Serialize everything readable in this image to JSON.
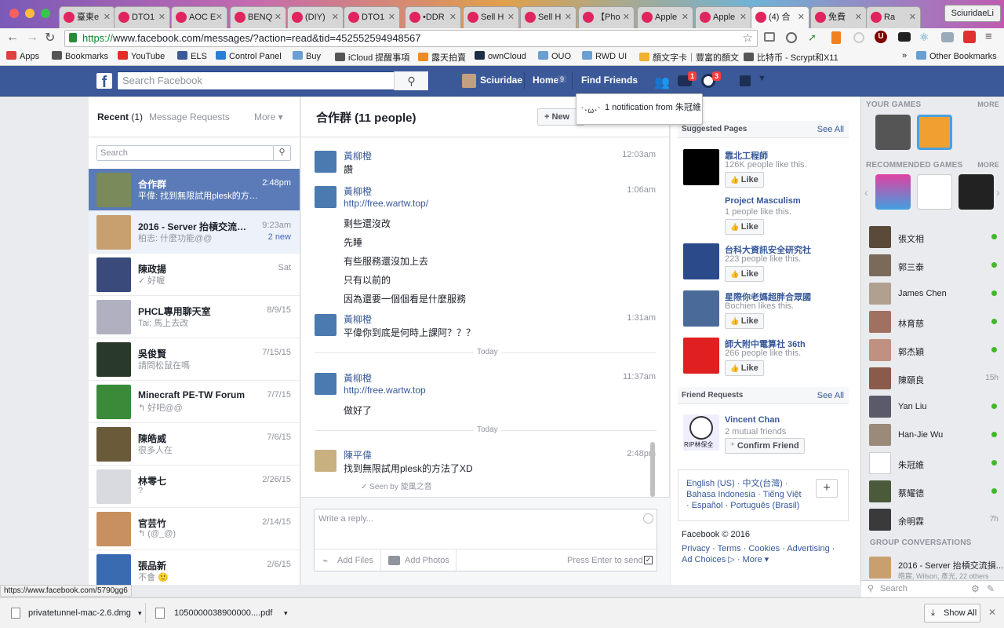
{
  "browser": {
    "tabs": [
      {
        "label": "臺東e",
        "active": false
      },
      {
        "label": "DTO1",
        "active": false
      },
      {
        "label": "AOC E",
        "active": false
      },
      {
        "label": "BENQ",
        "active": false
      },
      {
        "label": "(DIY)",
        "active": false
      },
      {
        "label": "DTO1",
        "active": false
      },
      {
        "label": "•DDR",
        "active": false
      },
      {
        "label": "Sell H",
        "active": false
      },
      {
        "label": "Sell H",
        "active": false
      },
      {
        "label": "【Pho",
        "active": false
      },
      {
        "label": "Apple",
        "active": false
      },
      {
        "label": "Apple",
        "active": false
      },
      {
        "label": "(4) 合",
        "active": true
      },
      {
        "label": "免費",
        "active": false
      },
      {
        "label": "Ra",
        "active": false
      }
    ],
    "profile_name": "SciuridaeLi",
    "url_scheme": "https://",
    "url_rest": "www.facebook.com/messages/?action=read&tid=452552594948567",
    "bookmarks": [
      {
        "label": "Apps",
        "color": "#e04040"
      },
      {
        "label": "Bookmarks",
        "color": "#555555"
      },
      {
        "label": "YouTube",
        "color": "#e52d27"
      },
      {
        "label": "ELS",
        "color": "#3b5998"
      },
      {
        "label": "Control Panel",
        "color": "#2a7fd4"
      },
      {
        "label": "Buy",
        "color": "#6a9fd4"
      },
      {
        "label": "iCloud 提醒事項",
        "color": "#555555"
      },
      {
        "label": "露天拍賣",
        "color": "#f08a24"
      },
      {
        "label": "ownCloud",
        "color": "#1d2d44"
      },
      {
        "label": "OUO",
        "color": "#6a9fd4"
      },
      {
        "label": "RWD UI",
        "color": "#6a9fd4"
      },
      {
        "label": "顏文字卡｜豐富的顏文",
        "color": "#f0b030"
      },
      {
        "label": "比特币 - Scrypt和X11",
        "color": "#555555"
      }
    ],
    "bookmarks_more": "»",
    "other_bookmarks": "Other Bookmarks",
    "status_url": "https://www.facebook.com/5790gg6"
  },
  "fb": {
    "search_placeholder": "Search Facebook",
    "user_name": "Sciuridae",
    "home_label": "Home",
    "home_count": "9",
    "find_friends": "Find Friends",
    "messages_badge": "1",
    "notif_badge": "3",
    "notif_popup": "1 notification from 朱冠維",
    "notif_face": "´･ω･`"
  },
  "inbox": {
    "tab_recent": "Recent",
    "tab_recent_count": "(1)",
    "tab_requests": "Message Requests",
    "tab_more": "More ▾",
    "search_placeholder": "Search",
    "conversations": [
      {
        "name": "合作群",
        "snippet": "平偉: 找到無限試用plesk的方法了..",
        "time": "2:48pm",
        "new": "",
        "state": "selected",
        "color": "#7a8a5a"
      },
      {
        "name": "2016 - Server 抬槓交流損友...",
        "snippet": "柏志: 什麼功能@@",
        "time": "9:23am",
        "new": "2 new",
        "state": "unread",
        "color": "#c8a070"
      },
      {
        "name": "陳政揚",
        "snippet": "✓ 好喔",
        "time": "Sat",
        "new": "",
        "state": "",
        "color": "#3a4a7a"
      },
      {
        "name": "PHCL專用聊天室",
        "snippet": "Tai: 馬上去改",
        "time": "8/9/15",
        "new": "",
        "state": "",
        "color": "#b0b0c0"
      },
      {
        "name": "吳俊賢",
        "snippet": "請問松鼠在嗎",
        "time": "7/15/15",
        "new": "",
        "state": "",
        "color": "#2a3a2a"
      },
      {
        "name": "Minecraft PE-TW Forum",
        "snippet": "↰ 好吧@@",
        "time": "7/7/15",
        "new": "",
        "state": "",
        "color": "#3a8a3a"
      },
      {
        "name": "陳皓威",
        "snippet": "很多人在",
        "time": "7/6/15",
        "new": "",
        "state": "",
        "color": "#6a5a3a"
      },
      {
        "name": "林零七",
        "snippet": "?",
        "time": "2/26/15",
        "new": "",
        "state": "",
        "color": "#d8dadf"
      },
      {
        "name": "官芸竹",
        "snippet": "↰ (@_@)",
        "time": "2/14/15",
        "new": "",
        "state": "",
        "color": "#c89060"
      },
      {
        "name": "張品新",
        "snippet": "不會 🙂",
        "time": "2/6/15",
        "new": "",
        "state": "",
        "color": "#3a6ab0"
      }
    ]
  },
  "thread": {
    "title": "合作群 (11 people)",
    "new_button": "+ New",
    "today_label": "Today",
    "seen_text": "✓ Seen by 旋風之音",
    "reply_placeholder": "Write a reply...",
    "add_files": "Add Files",
    "add_photos": "Add Photos",
    "press_enter": "Press Enter to send",
    "messages": [
      {
        "sender": "黃柳橙",
        "time": "12:03am",
        "lines": [
          "讚"
        ]
      },
      {
        "sender": "黃柳橙",
        "time": "1:06am",
        "lines": [
          "http://free.wartw.top/",
          "剩些還沒改",
          "先睡",
          "有些服務還沒加上去",
          "只有以前的",
          "因為還要一個個看是什麼服務"
        ]
      },
      {
        "sender": "黃柳橙",
        "time": "1:31am",
        "lines": [
          "平偉你到底是何時上課阿？？？"
        ]
      },
      {
        "sender": "黃柳橙",
        "time": "11:37am",
        "lines": [
          "http://free.wartw.top",
          "做好了"
        ]
      },
      {
        "sender": "陳平偉",
        "time": "2:48pm",
        "lines": [
          "找到無限試用plesk的方法了XD"
        ]
      }
    ]
  },
  "right": {
    "suggested_pages": "Suggested Pages",
    "see_all": "See All",
    "like": "Like",
    "pages": [
      {
        "name": "靠北工程師",
        "likes": "126K people like this.",
        "color": "#000000"
      },
      {
        "name": "Project Masculism",
        "likes": "1 people like this.",
        "color": "#ffffff"
      },
      {
        "name": "台科大資訊安全研究社",
        "likes": "223 people like this.",
        "color": "#2a4a8a"
      },
      {
        "name": "星際你老媽超胖合眾國",
        "likes": "Bochien likes this.",
        "color": "#4a6a9a"
      },
      {
        "name": "師大附中電算社 36th",
        "likes": "266 people like this.",
        "color": "#e02020"
      }
    ],
    "friend_requests": "Friend Requests",
    "fr_name": "Vincent Chan",
    "fr_mutual": "2 mutual friends",
    "fr_confirm": "Confirm Friend",
    "fr_caption": "RIP林保全",
    "languages": "English (US) · 中文(台灣) · Bahasa Indonesia · Tiếng Việt · Español · Português (Brasil)",
    "copyright": "Facebook © 2016",
    "footer_links": "Privacy · Terms · Cookies · Advertising · Ad Choices ▷ · More ▾"
  },
  "sidebar": {
    "your_games": "YOUR GAMES",
    "more": "MORE",
    "recommended_games": "RECOMMENDED GAMES",
    "friends": [
      {
        "name": "張文相",
        "status": "online",
        "time": "",
        "color": "#5a4a3a"
      },
      {
        "name": "郭三泰",
        "status": "online",
        "time": "",
        "color": "#7a6a5a"
      },
      {
        "name": "James Chen",
        "status": "online",
        "time": "",
        "color": "#b0a090"
      },
      {
        "name": "林育慈",
        "status": "online",
        "time": "",
        "color": "#a07060"
      },
      {
        "name": "郭杰穎",
        "status": "online",
        "time": "",
        "color": "#c09080"
      },
      {
        "name": "陳頤良",
        "status": "",
        "time": "15h",
        "color": "#8a5a4a"
      },
      {
        "name": "Yan Liu",
        "status": "online",
        "time": "",
        "color": "#5a5a6a"
      },
      {
        "name": "Han-Jie Wu",
        "status": "online",
        "time": "",
        "color": "#9a8a7a"
      },
      {
        "name": "朱冠維",
        "status": "online",
        "time": "",
        "color": "#ffffff"
      },
      {
        "name": "蔡耀德",
        "status": "online",
        "time": "",
        "color": "#4a5a3a"
      },
      {
        "name": "余明霖",
        "status": "",
        "time": "7h",
        "color": "#3a3a3a"
      }
    ],
    "group_conversations": "GROUP CONVERSATIONS",
    "group_name": "2016 - Server 抬槓交流損...",
    "group_members": "皓宸, Wilson, 彥光, 22 others",
    "search_placeholder": "Search"
  },
  "downloads": {
    "item1": "privatetunnel-mac-2.6.dmg",
    "item2": "1050000038900000....pdf",
    "show_all": "Show All"
  }
}
